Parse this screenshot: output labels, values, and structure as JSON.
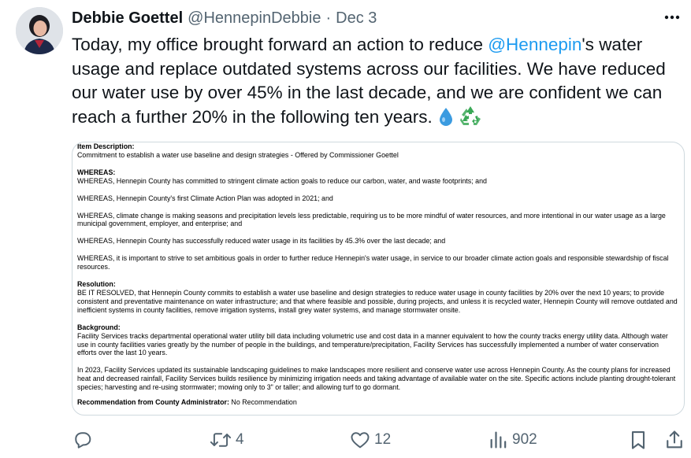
{
  "author": {
    "name": "Debbie Goettel",
    "handle": "@HennepinDebbie",
    "separator": "·",
    "date": "Dec 3"
  },
  "tweet": {
    "text_before_mention": "Today, my office brought forward an action to reduce ",
    "mention": "@Hennepin",
    "text_after_mention": "'s water usage and replace outdated systems across our facilities. We have reduced our water use by over 45% in the last decade, and we are confident we can reach a further 20% in the following ten years.",
    "emojis": [
      "droplet-icon",
      "recycle-icon"
    ]
  },
  "document": {
    "item_heading": "Item Description:",
    "item_text": "Commitment to establish a water use baseline and design strategies - Offered by Commissioner Goettel",
    "whereas_heading": "WHEREAS:",
    "whereas": [
      "WHEREAS, Hennepin County has committed to stringent climate action goals to reduce our carbon, water, and waste footprints; and",
      "WHEREAS, Hennepin County's first Climate Action Plan was adopted in 2021; and",
      "WHEREAS, climate change is making seasons and precipitation levels less predictable, requiring us to be more mindful of water resources, and more intentional in our water usage as a large municipal government, employer, and enterprise; and",
      "WHEREAS, Hennepin County has successfully reduced water usage in its facilities by 45.3% over the last decade; and",
      "WHEREAS, it is important to strive to set ambitious goals in order to further reduce Hennepin's water usage, in service to our broader climate action goals and responsible stewardship of fiscal resources."
    ],
    "resolution_heading": "Resolution:",
    "resolution": "BE IT RESOLVED, that Hennepin County commits to establish a water use baseline and design strategies to reduce water usage in county facilities by 20% over the next 10 years; to provide consistent and preventative maintenance on water infrastructure; and that where feasible and possible, during projects, and unless it is recycled water, Hennepin County will remove outdated and inefficient systems in county facilities, remove irrigation systems, install grey water systems, and manage stormwater onsite.",
    "background_heading": "Background:",
    "background": [
      "Facility Services tracks departmental operational water utility bill data including volumetric use and cost data in a manner equivalent to how the county tracks energy utility data. Although water use in county facilities varies greatly by the number of people in the buildings, and temperature/precipitation, Facility Services has successfully implemented a number of water conservation efforts over the last 10 years.",
      "In 2023, Facility Services updated its sustainable landscaping guidelines to make landscapes more resilient and conserve water use across Hennepin County. As the county plans for increased heat and decreased rainfall, Facility Services builds resilience by minimizing irrigation needs and taking advantage of available water on the site. Specific actions include planting drought-tolerant species; harvesting and re-using stormwater; mowing only to 3\" or taller; and allowing turf to go dormant."
    ],
    "recommendation_heading": "Recommendation from County Administrator:",
    "recommendation_value": " No Recommendation"
  },
  "actions": {
    "reply_count": "",
    "retweet_count": "4",
    "like_count": "12",
    "views_count": "902"
  },
  "colors": {
    "accent": "#1d9bf0",
    "text": "#0f1419",
    "muted": "#536471",
    "border": "#cfd9de"
  }
}
